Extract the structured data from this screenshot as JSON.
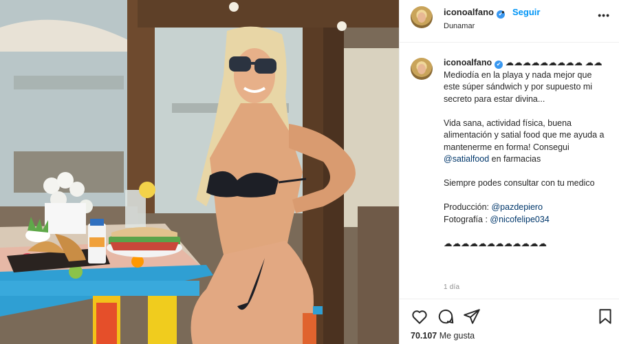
{
  "post": {
    "username": "iconoalfano",
    "verified_glyph": "✔",
    "separator": "•",
    "follow_label": "Seguir",
    "location": "Dunamar",
    "more_label": "•••"
  },
  "caption": {
    "username": "iconoalfano",
    "emoji_run_1": "☁☁☁☁☁☁☁☁☁",
    "line_1": "Mediodía en la playa y nada mejor que este súper sándwich y por supuesto mi secreto para estar divina...",
    "emoji_run_2": "☁☁",
    "para_2": "Vida sana, actividad física, buena alimentación y satial food que me ayuda a mantenerme en forma!",
    "para_2b_prefix": "Consegui ",
    "para_2b_mention": "@satialfood",
    "para_2b_suffix": " en farmacias",
    "para_3": "Siempre podes consultar con tu medico",
    "prod_label": "Producción: ",
    "prod_mention": "@pazdepiero",
    "foto_label": "Fotografía : ",
    "foto_mention": "@nicofelipe034",
    "emoji_run_3": "☁☁☁☁☁☁☁☁☁☁☁☁",
    "time_ago": "1 día"
  },
  "actions": {
    "like_icon": "heart-icon",
    "comment_icon": "comment-icon",
    "share_icon": "share-icon",
    "save_icon": "bookmark-icon",
    "likes_count": "70.107",
    "likes_label": " Me gusta"
  },
  "colors": {
    "accent": "#0095f6",
    "verified": "#3897f0",
    "mention": "#00376b",
    "muted": "#8e8e8e",
    "border": "#efefef"
  }
}
